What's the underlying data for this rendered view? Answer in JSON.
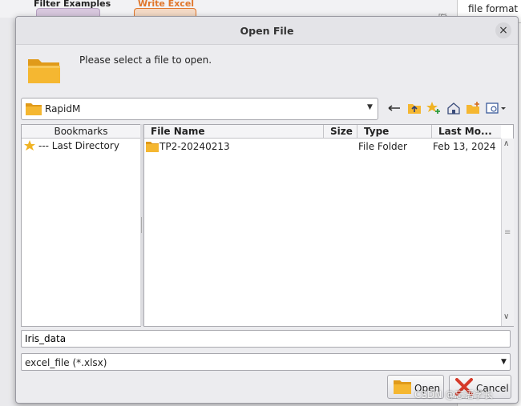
{
  "background": {
    "op1": "Filter Examples",
    "op2": "Write Excel",
    "right_panel_text": "file format",
    "small_text": "res",
    "link1": "o",
    "link2": "e"
  },
  "dialog": {
    "title": "Open File",
    "close_glyph": "×",
    "message": "Please select a file to open."
  },
  "look_in": {
    "value": "RapidM",
    "arrow": "▼"
  },
  "toolbar": {
    "up_glyph": "⟵",
    "icons": [
      "back-arrow-icon",
      "up-folder-icon",
      "add-bookmark-icon",
      "home-icon",
      "new-folder-icon",
      "view-menu-icon"
    ]
  },
  "bookmarks": {
    "header": "Bookmarks",
    "items": [
      {
        "label": "--- Last Directory",
        "icon": "star-icon"
      }
    ]
  },
  "files": {
    "columns": [
      "File Name",
      "Size",
      "Type",
      "Last Mo..."
    ],
    "rows": [
      {
        "name": "TP2-20240213",
        "size": "",
        "type": "File Folder",
        "modified": "Feb 13, 2024"
      }
    ],
    "scroll_up": "∧",
    "scroll_down": "∨",
    "scroll_grip": "≡"
  },
  "file_name_input": {
    "value": "Iris_data"
  },
  "file_type": {
    "value": "excel_file (*.xlsx)",
    "arrow": "▼"
  },
  "buttons": {
    "open": "Open",
    "cancel": "Cancel"
  },
  "watermark": "CSDN @忘语学长",
  "colors": {
    "folder": "#f5b731",
    "folder_dark": "#e09a1a",
    "star": "#f0b323",
    "cancel_x": "#d63a2a"
  }
}
